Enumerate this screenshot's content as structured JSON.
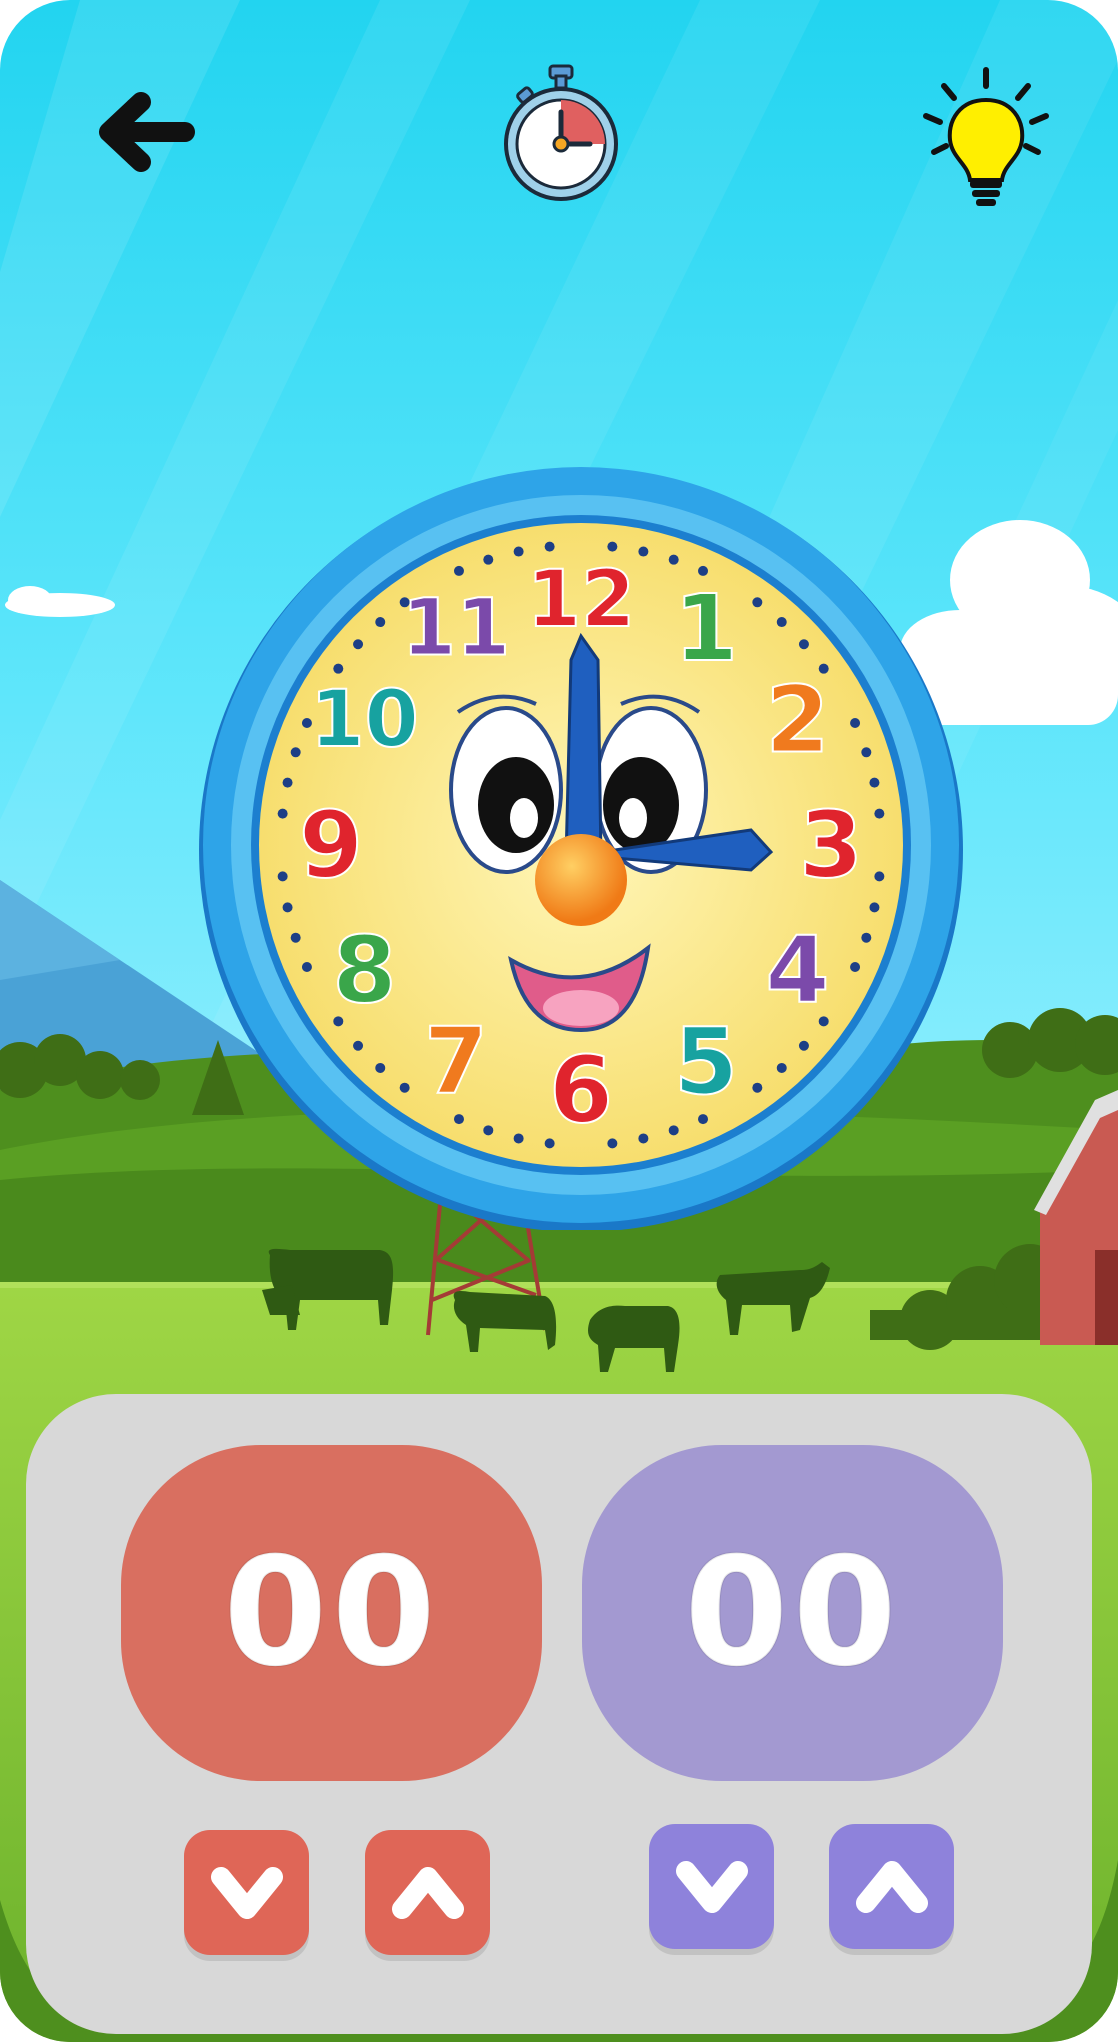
{
  "toolbar": {
    "back_icon": "back-arrow-icon",
    "timer_icon": "stopwatch-icon",
    "hint_icon": "lightbulb-icon"
  },
  "clock": {
    "numerals": [
      "12",
      "1",
      "2",
      "3",
      "4",
      "5",
      "6",
      "7",
      "8",
      "9",
      "10",
      "11"
    ],
    "numeral_colors": [
      "#e0242d",
      "#3aa64a",
      "#f07a1e",
      "#e0242d",
      "#7b4aaa",
      "#17a2a0",
      "#e0242d",
      "#f07a1e",
      "#3aa64a",
      "#e0242d",
      "#17a2a0",
      "#7b4aaa"
    ],
    "shown_time": "3:00"
  },
  "time_input": {
    "hours_value": "00",
    "minutes_value": "00",
    "hours_color": "#d96f60",
    "minutes_color": "#a399d1"
  },
  "controls": {
    "hours_down_icon": "chevron-down-icon",
    "hours_up_icon": "chevron-up-icon",
    "minutes_down_icon": "chevron-down-icon",
    "minutes_up_icon": "chevron-up-icon"
  }
}
